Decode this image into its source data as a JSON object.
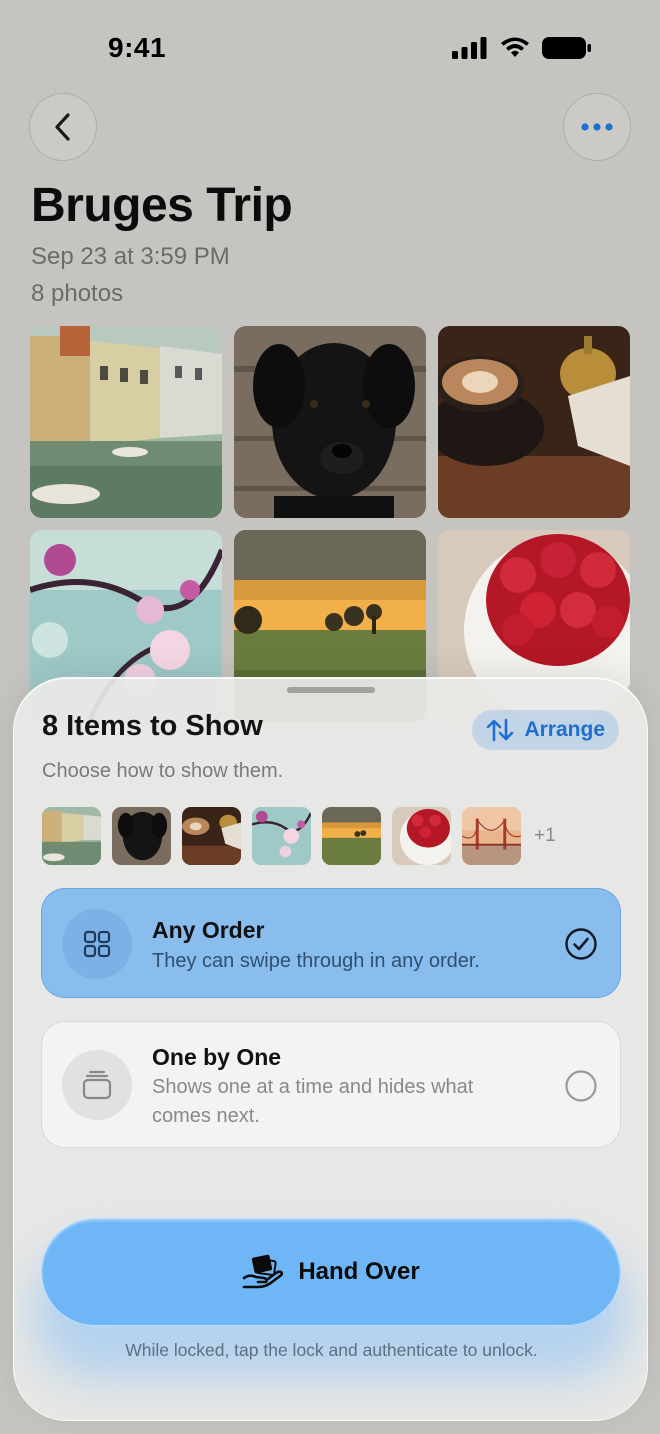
{
  "status_bar": {
    "time": "9:41"
  },
  "album": {
    "title": "Bruges Trip",
    "date": "Sep 23 at 3:59 PM",
    "count": "8 photos"
  },
  "photos": [
    {
      "subject": "bruges-canal"
    },
    {
      "subject": "black-puppy"
    },
    {
      "subject": "latte-coffee"
    },
    {
      "subject": "cherry-blossom"
    },
    {
      "subject": "sunset-field"
    },
    {
      "subject": "raspberries-bowl"
    }
  ],
  "sheet": {
    "title": "8 Items to Show",
    "subtitle": "Choose how to show them.",
    "arrange_label": "Arrange",
    "thumbs_more": "+1",
    "options": [
      {
        "title": "Any Order",
        "description": "They can swipe through in any order.",
        "selected": true,
        "icon": "grid-icon"
      },
      {
        "title": "One by One",
        "description": "Shows one at a time and hides what comes next.",
        "selected": false,
        "icon": "stack-icon"
      }
    ],
    "handover_label": "Hand Over",
    "footnote": "While locked, tap the lock and authenticate to unlock."
  },
  "colors": {
    "accent": "#1f6fd1",
    "selected_option": "#88bdee",
    "handover_button": "#6fb6f7",
    "background": "#c6c4c1"
  }
}
